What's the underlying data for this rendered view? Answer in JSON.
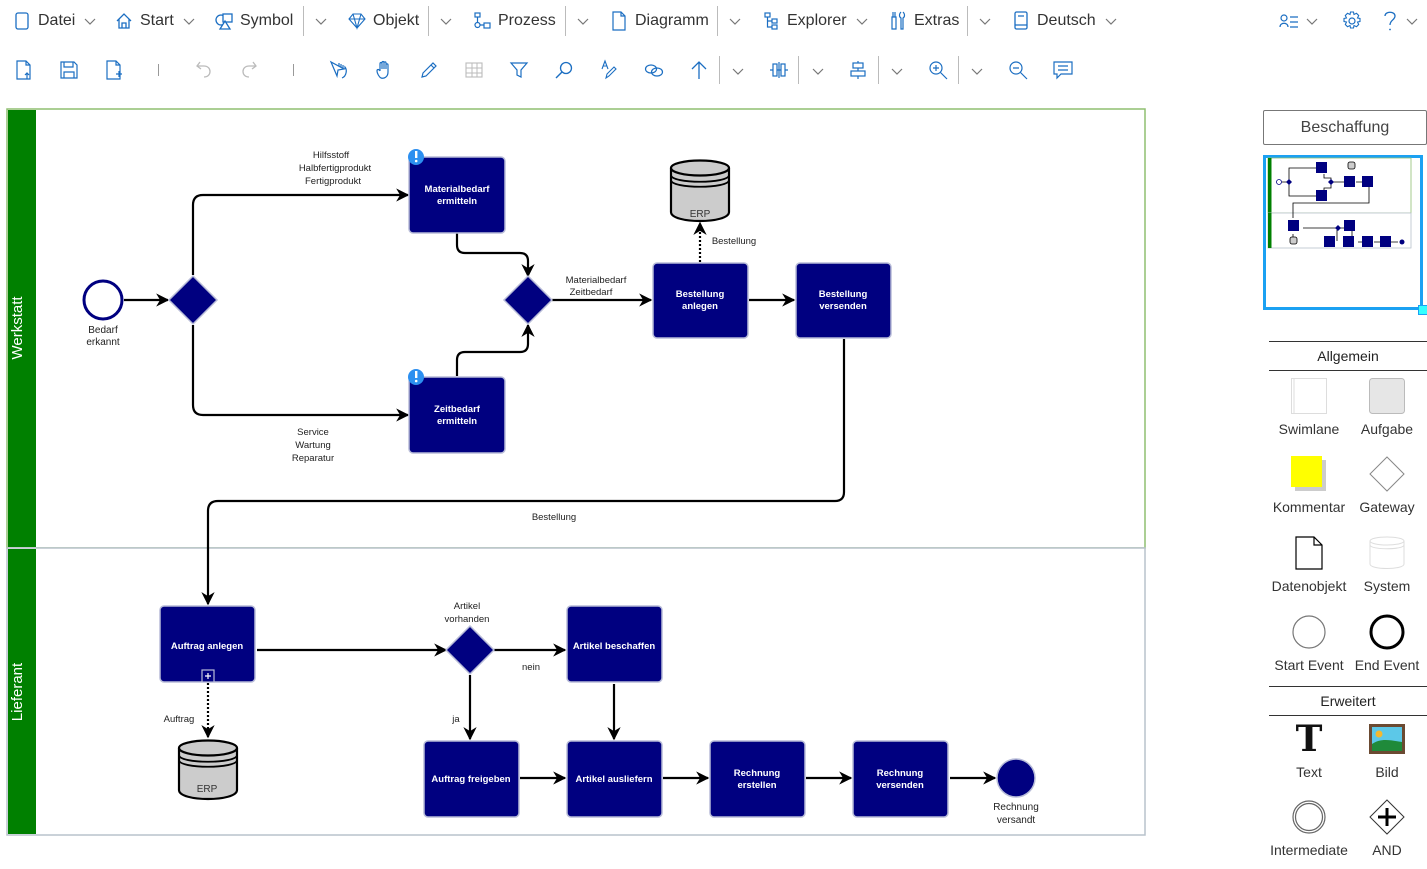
{
  "menubar": {
    "items": [
      {
        "label": "Datei",
        "icon": "file-icon"
      },
      {
        "label": "Start",
        "icon": "home-icon"
      },
      {
        "label": "Symbol",
        "icon": "shapes-icon"
      },
      {
        "label": "Objekt",
        "icon": "diamond-gem-icon"
      },
      {
        "label": "Prozess",
        "icon": "process-icon"
      },
      {
        "label": "Diagramm",
        "icon": "document-icon"
      },
      {
        "label": "Explorer",
        "icon": "tree-icon"
      },
      {
        "label": "Extras",
        "icon": "tools-icon"
      },
      {
        "label": "Deutsch",
        "icon": "book-icon"
      }
    ],
    "right_icons": [
      "user-list-icon",
      "gear-icon",
      "help-icon"
    ]
  },
  "toolbar": {
    "buttons": [
      "open-file",
      "save",
      "new-file",
      "undo",
      "redo",
      "select-pointer",
      "pan-hand",
      "pencil",
      "table",
      "filter",
      "search",
      "text-format",
      "link",
      "arrow-up",
      "distribute",
      "align-center",
      "zoom-in",
      "zoom-out",
      "comment"
    ]
  },
  "colors": {
    "accent": "#1b6ec2",
    "task_fill": "#000080",
    "lane_header": "#008000",
    "minimap_border": "#1ba1f2",
    "comment_yellow": "#ffff00"
  },
  "diagram": {
    "lanes": [
      {
        "name": "Werkstatt"
      },
      {
        "name": "Lieferant"
      }
    ],
    "start_event": {
      "label_1": "Bedarf",
      "label_2": "erkannt"
    },
    "tasks": {
      "materialbedarf": {
        "l1": "Materialbedarf",
        "l2": "ermitteln"
      },
      "zeitbedarf": {
        "l1": "Zeitbedarf",
        "l2": "ermitteln"
      },
      "bestellung_anlegen": {
        "l1": "Bestellung",
        "l2": "anlegen"
      },
      "bestellung_versenden": {
        "l1": "Bestellung",
        "l2": "versenden"
      },
      "auftrag_anlegen": {
        "l1": "Auftrag anlegen"
      },
      "artikel_beschaffen": {
        "l1": "Artikel beschaffen"
      },
      "auftrag_freigeben": {
        "l1": "Auftrag freigeben"
      },
      "artikel_ausliefern": {
        "l1": "Artikel ausliefern"
      },
      "rechnung_erstellen": {
        "l1": "Rechnung",
        "l2": "erstellen"
      },
      "rechnung_versenden": {
        "l1": "Rechnung",
        "l2": "versenden"
      }
    },
    "systems": {
      "erp_top": "ERP",
      "erp_bottom": "ERP"
    },
    "edge_labels": {
      "upper_1": "Hilfsstoff",
      "upper_2": "Halbfertigprodukt",
      "upper_3": "Fertigprodukt",
      "lower_1": "Service",
      "lower_2": "Wartung",
      "lower_3": "Reparatur",
      "merge_1": "Materialbedarf",
      "merge_2": "Zeitbedarf",
      "erp_write": "Bestellung",
      "cross_lane": "Bestellung",
      "auftrag": "Auftrag",
      "gateway_q1": "Artikel",
      "gateway_q2": "vorhanden",
      "nein": "nein",
      "ja": "ja"
    },
    "end_event": {
      "label_1": "Rechnung",
      "label_2": "versandt"
    }
  },
  "panel": {
    "title": "Beschaffung",
    "sections": [
      {
        "title": "Allgemein",
        "items": [
          "Swimlane",
          "Aufgabe",
          "Kommentar",
          "Gateway",
          "Datenobjekt",
          "System",
          "Start Event",
          "End Event"
        ]
      },
      {
        "title": "Erweitert",
        "items": [
          "Text",
          "Bild",
          "Intermediate",
          "AND"
        ]
      }
    ]
  }
}
